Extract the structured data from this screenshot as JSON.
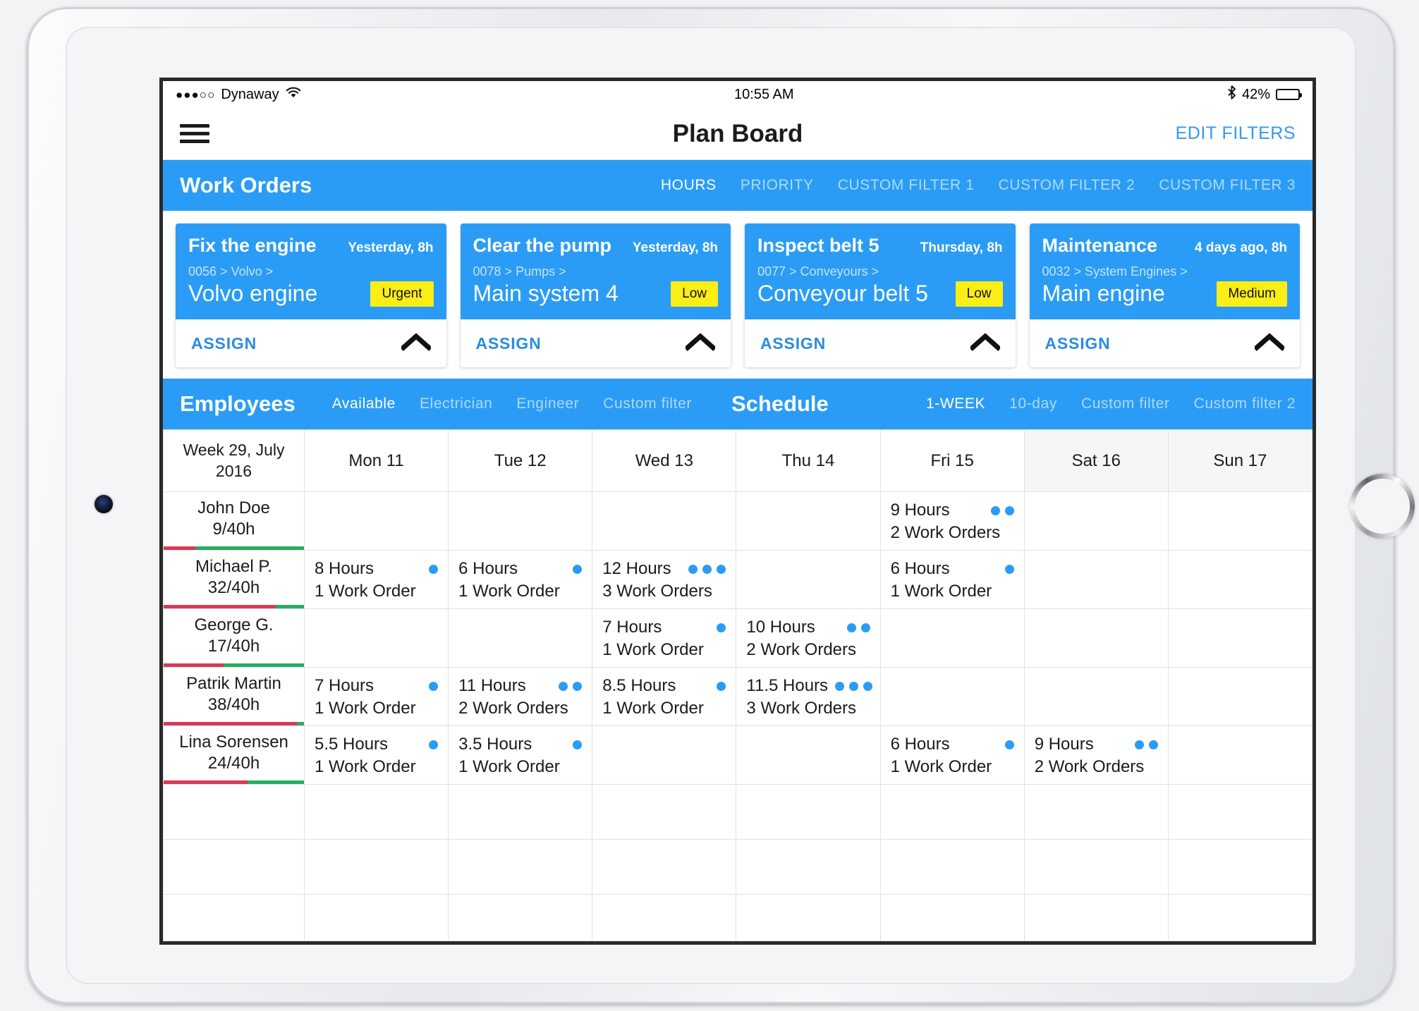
{
  "status_bar": {
    "signal_dots": "●●●○○",
    "carrier": "Dynaway",
    "wifi_icon": "wifi-icon",
    "time": "10:55 AM",
    "bluetooth_icon": "✶",
    "battery_percent": "42%",
    "battery_level": 42
  },
  "nav": {
    "menu_icon": "hamburger-menu-icon",
    "title": "Plan Board",
    "edit_filters_label": "EDIT FILTERS"
  },
  "work_orders_section": {
    "title": "Work Orders",
    "filters": [
      {
        "label": "HOURS",
        "active": true
      },
      {
        "label": "PRIORITY",
        "active": false
      },
      {
        "label": "CUSTOM FILTER 1",
        "active": false
      },
      {
        "label": "CUSTOM FILTER 2",
        "active": false
      },
      {
        "label": "CUSTOM FILTER 3",
        "active": false
      }
    ],
    "assign_label": "ASSIGN",
    "cards": [
      {
        "name": "Fix the engine",
        "due": "Yesterday, 8h",
        "path": "0056 > Volvo >",
        "asset": "Volvo engine",
        "priority": "Urgent"
      },
      {
        "name": "Clear the pump",
        "due": "Yesterday, 8h",
        "path": "0078 > Pumps >",
        "asset": "Main system 4",
        "priority": "Low"
      },
      {
        "name": "Inspect belt 5",
        "due": "Thursday, 8h",
        "path": "0077 > Conveyours >",
        "asset": "Conveyour belt 5",
        "priority": "Low"
      },
      {
        "name": "Maintenance",
        "due": "4 days ago, 8h",
        "path": "0032 > System Engines >",
        "asset": "Main engine",
        "priority": "Medium"
      }
    ]
  },
  "employees_section": {
    "title": "Employees",
    "filters": [
      {
        "label": "Available",
        "active": true
      },
      {
        "label": "Electrician",
        "active": false
      },
      {
        "label": "Engineer",
        "active": false
      },
      {
        "label": "Custom filter",
        "active": false
      }
    ]
  },
  "schedule_section": {
    "title": "Schedule",
    "filters": [
      {
        "label": "1-WEEK",
        "active": true
      },
      {
        "label": "10-day",
        "active": false
      },
      {
        "label": "Custom filter",
        "active": false
      },
      {
        "label": "Custom filter 2",
        "active": false
      }
    ]
  },
  "schedule": {
    "week_label_line1": "Week 29, July",
    "week_label_line2": "2016",
    "days": [
      {
        "label": "Mon 11",
        "weekend": false
      },
      {
        "label": "Tue 12",
        "weekend": false
      },
      {
        "label": "Wed 13",
        "weekend": false
      },
      {
        "label": "Thu 14",
        "weekend": false
      },
      {
        "label": "Fri 15",
        "weekend": false
      },
      {
        "label": "Sat 16",
        "weekend": true
      },
      {
        "label": "Sun 17",
        "weekend": true
      }
    ],
    "employees": [
      {
        "name": "John Doe",
        "hours": "9/40h",
        "used": 9,
        "capacity": 40,
        "cells": [
          null,
          null,
          null,
          null,
          {
            "hours": "9 Hours",
            "orders": "2 Work Orders",
            "dots": 2
          },
          null,
          null
        ]
      },
      {
        "name": "Michael P.",
        "hours": "32/40h",
        "used": 32,
        "capacity": 40,
        "cells": [
          {
            "hours": "8 Hours",
            "orders": "1 Work Order",
            "dots": 1
          },
          {
            "hours": "6 Hours",
            "orders": "1 Work Order",
            "dots": 1
          },
          {
            "hours": "12 Hours",
            "orders": "3 Work Orders",
            "dots": 3
          },
          null,
          {
            "hours": "6 Hours",
            "orders": "1 Work Order",
            "dots": 1
          },
          null,
          null
        ]
      },
      {
        "name": "George G.",
        "hours": "17/40h",
        "used": 17,
        "capacity": 40,
        "cells": [
          null,
          null,
          {
            "hours": "7 Hours",
            "orders": "1 Work Order",
            "dots": 1
          },
          {
            "hours": "10 Hours",
            "orders": "2 Work Orders",
            "dots": 2
          },
          null,
          null,
          null
        ]
      },
      {
        "name": "Patrik Martin",
        "hours": "38/40h",
        "used": 38,
        "capacity": 40,
        "cells": [
          {
            "hours": "7 Hours",
            "orders": "1 Work Order",
            "dots": 1
          },
          {
            "hours": "11 Hours",
            "orders": "2 Work Orders",
            "dots": 2
          },
          {
            "hours": "8.5 Hours",
            "orders": "1 Work Order",
            "dots": 1
          },
          {
            "hours": "11.5 Hours",
            "orders": "3 Work Orders",
            "dots": 3
          },
          null,
          null,
          null
        ]
      },
      {
        "name": "Lina Sorensen",
        "hours": "24/40h",
        "used": 24,
        "capacity": 40,
        "cells": [
          {
            "hours": "5.5 Hours",
            "orders": "1 Work Order",
            "dots": 1
          },
          {
            "hours": "3.5 Hours",
            "orders": "1 Work Order",
            "dots": 1
          },
          null,
          null,
          {
            "hours": "6 Hours",
            "orders": "1 Work Order",
            "dots": 1
          },
          {
            "hours": "9 Hours",
            "orders": "2 Work Orders",
            "dots": 2
          },
          null
        ]
      }
    ],
    "empty_rows": 3
  },
  "colors": {
    "accent_blue": "#2b9cf5",
    "link_blue": "#3498f3",
    "badge_yellow": "#fbed16",
    "bar_used_red": "#d83a56",
    "bar_free_green": "#27ae60",
    "dot_blue": "#2b9cf5"
  }
}
